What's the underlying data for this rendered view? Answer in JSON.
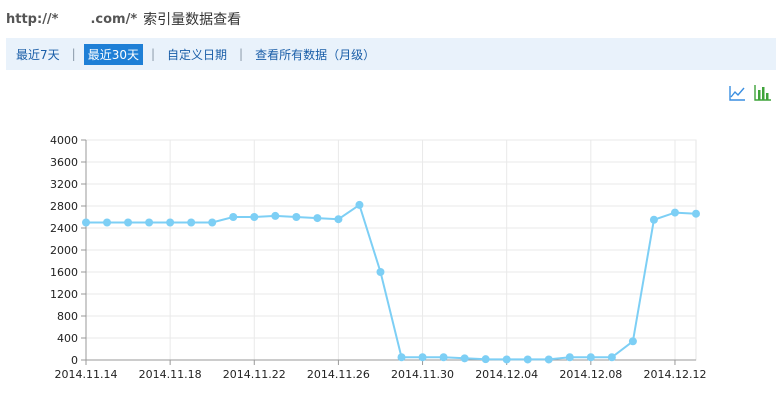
{
  "header": {
    "url_prefix": "http://*",
    "url_suffix": ".com/*",
    "title": "索引量数据查看"
  },
  "tabs": [
    {
      "label": "最近7天",
      "active": false
    },
    {
      "label": "最近30天",
      "active": true
    },
    {
      "label": "自定义日期",
      "active": false
    },
    {
      "label": "查看所有数据（月级）",
      "active": false
    }
  ],
  "tab_separator": "|",
  "icons": [
    "line-chart-icon",
    "bar-chart-icon"
  ],
  "colors": {
    "line": "#7dcff5",
    "accent": "#1e7fd6",
    "tabbar_bg": "#e9f2fb"
  },
  "chart_data": {
    "type": "line",
    "x": [
      "2014.11.14",
      "2014.11.15",
      "2014.11.16",
      "2014.11.17",
      "2014.11.18",
      "2014.11.19",
      "2014.11.20",
      "2014.11.21",
      "2014.11.22",
      "2014.11.23",
      "2014.11.24",
      "2014.11.25",
      "2014.11.26",
      "2014.11.27",
      "2014.11.28",
      "2014.11.29",
      "2014.11.30",
      "2014.12.01",
      "2014.12.02",
      "2014.12.03",
      "2014.12.04",
      "2014.12.05",
      "2014.12.06",
      "2014.12.07",
      "2014.12.08",
      "2014.12.09",
      "2014.12.10",
      "2014.12.11",
      "2014.12.12",
      "2014.12.13"
    ],
    "values": [
      2500,
      2500,
      2500,
      2500,
      2500,
      2500,
      2500,
      2600,
      2600,
      2620,
      2600,
      2580,
      2560,
      2820,
      1600,
      50,
      50,
      50,
      30,
      15,
      10,
      10,
      10,
      50,
      50,
      50,
      340,
      2550,
      2680,
      2660
    ],
    "xticks": [
      "2014.11.14",
      "2014.11.18",
      "2014.11.22",
      "2014.11.26",
      "2014.11.30",
      "2014.12.04",
      "2014.12.08",
      "2014.12.12"
    ],
    "yticks": [
      0,
      400,
      800,
      1200,
      1600,
      2000,
      2400,
      2800,
      3200,
      3600,
      4000
    ],
    "ylim": [
      0,
      4000
    ],
    "grid": true
  }
}
